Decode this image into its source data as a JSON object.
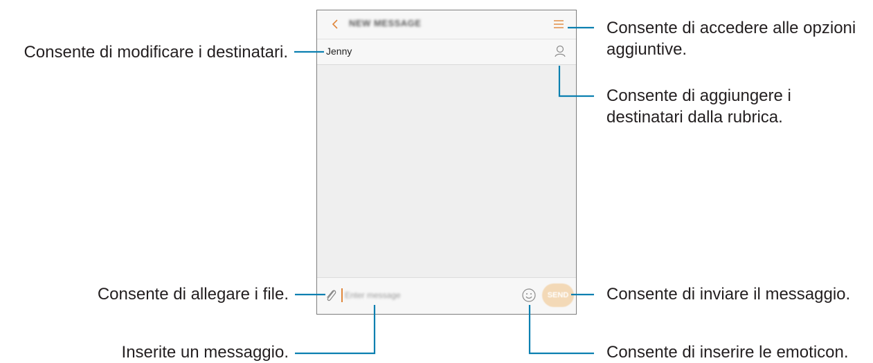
{
  "app": {
    "title": "NEW MESSAGE",
    "recipient": "Jenny",
    "input_placeholder": "Enter message",
    "send_label": "SEND",
    "accent_color": "#e0863a"
  },
  "icons": {
    "back": "chevron-left-icon",
    "menu": "more-options-icon",
    "contacts": "contact-person-icon",
    "attach": "paperclip-icon",
    "emoticon": "smiley-icon"
  },
  "callouts": {
    "edit_recipients": "Consente di modificare i destinatari.",
    "more_options_line1": "Consente di accedere alle opzioni",
    "more_options_line2": "aggiuntive.",
    "add_from_contacts_line1": "Consente di aggiungere i",
    "add_from_contacts_line2": "destinatari dalla rubrica.",
    "attach_files": "Consente di allegare i file.",
    "send_message": "Consente di inviare il messaggio.",
    "enter_message": "Inserite un messaggio.",
    "insert_emoticons": "Consente di inserire le emoticon."
  }
}
